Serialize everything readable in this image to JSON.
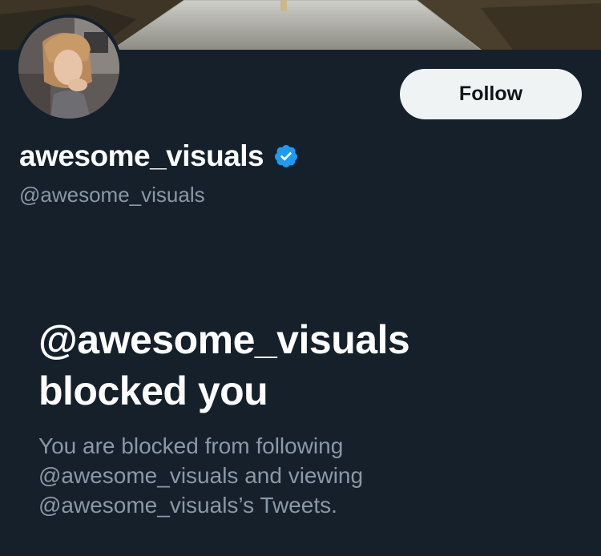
{
  "profile": {
    "display_name": "awesome_visuals",
    "handle": "@awesome_visuals",
    "verified": true,
    "follow_label": "Follow"
  },
  "blocked": {
    "title_line1": "@awesome_visuals",
    "title_line2": "blocked you",
    "desc_line1": "You are blocked from following",
    "desc_line2": "@awesome_visuals and viewing",
    "desc_line3": "@awesome_visuals’s Tweets."
  },
  "colors": {
    "background": "#15202b",
    "primary_text": "#ffffff",
    "secondary_text": "#8b98a5",
    "follow_button_bg": "#eff3f4",
    "verified_badge": "#1d9bf0"
  },
  "icons": {
    "verified": "verified-badge-icon"
  }
}
